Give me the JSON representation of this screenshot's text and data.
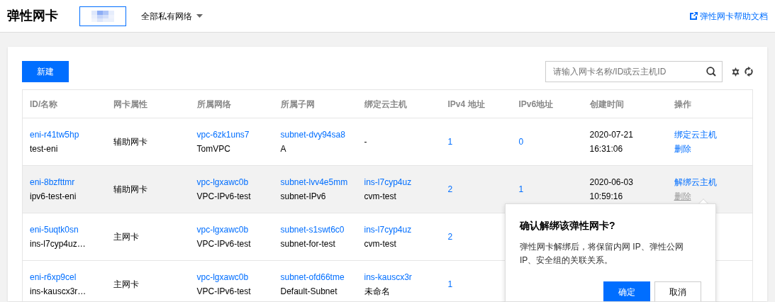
{
  "header": {
    "title": "弹性网卡",
    "network_filter": "全部私有网络",
    "help_link": "弹性网卡帮助文档"
  },
  "toolbar": {
    "create_button": "新建",
    "search": {
      "placeholder": "请输入网卡名称/ID或云主机ID"
    }
  },
  "table": {
    "columns": [
      "ID/名称",
      "网卡属性",
      "所属网络",
      "所属子网",
      "绑定云主机",
      "IPv4 地址",
      "IPv6地址",
      "创建时间",
      "操作"
    ],
    "rows": [
      {
        "highlighted": false,
        "id": "eni-r41tw5hp",
        "name": "test-eni",
        "attribute": "辅助网卡",
        "vpc_id": "vpc-6zk1uns7",
        "vpc_name": "TomVPC",
        "subnet_id": "subnet-dvy94sa8",
        "subnet_name": "A",
        "host_empty": "-",
        "ipv4": "1",
        "ipv6": "0",
        "created": [
          "2020-07-21",
          "16:31:06"
        ],
        "actions": [
          {
            "label": "绑定云主机",
            "disabled": false
          },
          {
            "label": "删除",
            "disabled": false
          }
        ]
      },
      {
        "highlighted": true,
        "id": "eni-8bzfttmr",
        "name": "ipv6-test-eni",
        "attribute": "辅助网卡",
        "vpc_id": "vpc-lgxawc0b",
        "vpc_name": "VPC-IPv6-test",
        "subnet_id": "subnet-lvv4e5mm",
        "subnet_name": "subnet-IPv6",
        "host_id": "ins-l7cyp4uz",
        "host_name": "cvm-test",
        "ipv4": "2",
        "ipv6": "1",
        "created": [
          "2020-06-03",
          "10:59:16"
        ],
        "actions": [
          {
            "label": "解绑云主机",
            "disabled": false
          },
          {
            "label": "删除",
            "disabled": true
          }
        ]
      },
      {
        "highlighted": false,
        "id": "eni-5uqtk0sn",
        "name": "ins-l7cyp4uz…",
        "attribute": "主网卡",
        "vpc_id": "vpc-lgxawc0b",
        "vpc_name": "VPC-IPv6-test",
        "subnet_id": "subnet-s1swt6c0",
        "subnet_name": "subnet-for-test",
        "host_id": "ins-l7cyp4uz",
        "host_name": "cvm-test",
        "ipv4": "2"
      },
      {
        "highlighted": false,
        "id": "eni-r6xp9cel",
        "name": "ins-kauscx3r…",
        "attribute": "主网卡",
        "vpc_id": "vpc-lgxawc0b",
        "vpc_name": "VPC-IPv6-test",
        "subnet_id": "subnet-ofd66tme",
        "subnet_name": "Default-Subnet",
        "host_id": "ins-kauscx3r",
        "host_name": "未命名",
        "ipv4": "1"
      }
    ]
  },
  "popover": {
    "title": "确认解绑该弹性网卡?",
    "message": "弹性网卡解绑后，将保留内网 IP、弹性公网 IP、安全组的关联关系。",
    "buttons": [
      {
        "label": "确定",
        "primary": true
      },
      {
        "label": "取消",
        "primary": false
      }
    ]
  }
}
